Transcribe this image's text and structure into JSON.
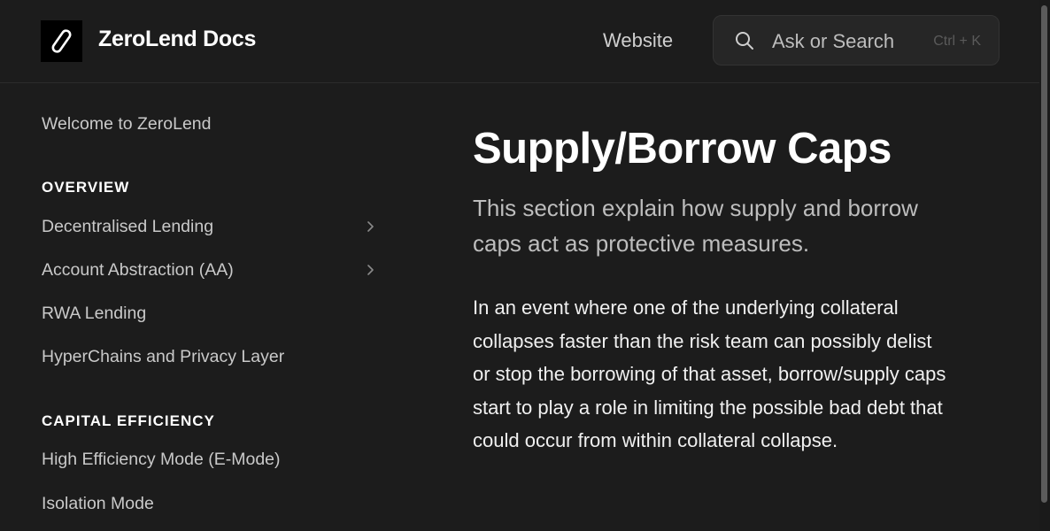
{
  "header": {
    "logo_icon": "paperclip-icon",
    "title": "ZeroLend Docs",
    "nav_link": "Website",
    "search": {
      "icon": "search-icon",
      "placeholder": "Ask or Search",
      "shortcut": "Ctrl + K"
    }
  },
  "sidebar": {
    "top_link": "Welcome to ZeroLend",
    "sections": [
      {
        "title": "OVERVIEW",
        "items": [
          {
            "label": "Decentralised Lending",
            "icon": "chevron-right-icon"
          },
          {
            "label": "Account Abstraction (AA)",
            "icon": "chevron-right-icon"
          },
          {
            "label": "RWA Lending"
          },
          {
            "label": "HyperChains and Privacy Layer"
          }
        ]
      },
      {
        "title": "CAPITAL EFFICIENCY",
        "items": [
          {
            "label": "High Efficiency Mode (E-Mode)"
          },
          {
            "label": "Isolation Mode"
          }
        ]
      }
    ]
  },
  "main": {
    "title": "Supply/Borrow Caps",
    "lead": "This section explain how supply and borrow caps act as protective measures.",
    "body": "In an event where one of the underlying collateral collapses faster than the risk team can possibly delist or stop the borrowing of that asset, borrow/supply caps start to play a role in limiting the possible bad debt that could occur from within collateral collapse."
  },
  "colors": {
    "background": "#1c1c1c",
    "text": "#ffffff",
    "muted": "#bdbdbd"
  }
}
